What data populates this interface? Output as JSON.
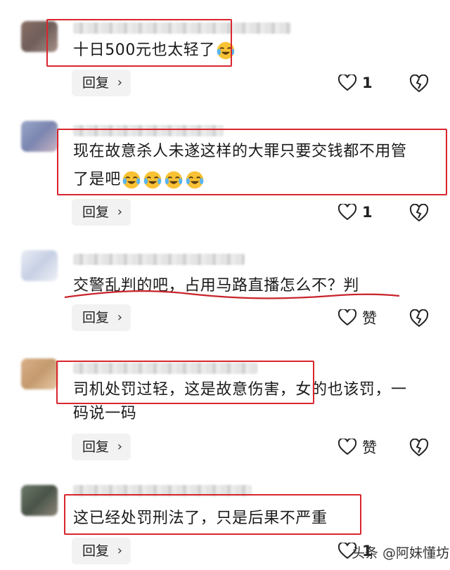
{
  "comments": [
    {
      "text_lines": [
        "十日500元也太轻了"
      ],
      "emoji_count": 1,
      "reply_label": "回复",
      "like_count": "1"
    },
    {
      "text_lines": [
        "现在故意杀人未遂这样的大罪只要交钱都不用管",
        "了是吧"
      ],
      "emoji_count": 4,
      "reply_label": "回复",
      "like_count": "1"
    },
    {
      "text_lines": [
        "交警乱判的吧，占用马路直播怎么不？判"
      ],
      "emoji_count": 0,
      "reply_label": "回复",
      "like_count": "赞"
    },
    {
      "text_lines": [
        "司机处罚过轻，这是故意伤害，女的也该罚，一",
        "码说一码"
      ],
      "emoji_count": 0,
      "reply_label": "回复",
      "like_count": "赞"
    },
    {
      "text_lines": [
        "这已经处罚刑法了，只是后果不严重"
      ],
      "emoji_count": 0,
      "reply_label": "回复",
      "like_count": "1"
    }
  ],
  "watermark": "头条 @阿妹懂坊",
  "icons": {
    "like": "heart-outline-icon",
    "dislike": "broken-heart-icon",
    "emoji": "laughing-crying-emoji-icon"
  },
  "colors": {
    "highlight": "#d9262e",
    "reply_bg": "#f2f2f2"
  }
}
